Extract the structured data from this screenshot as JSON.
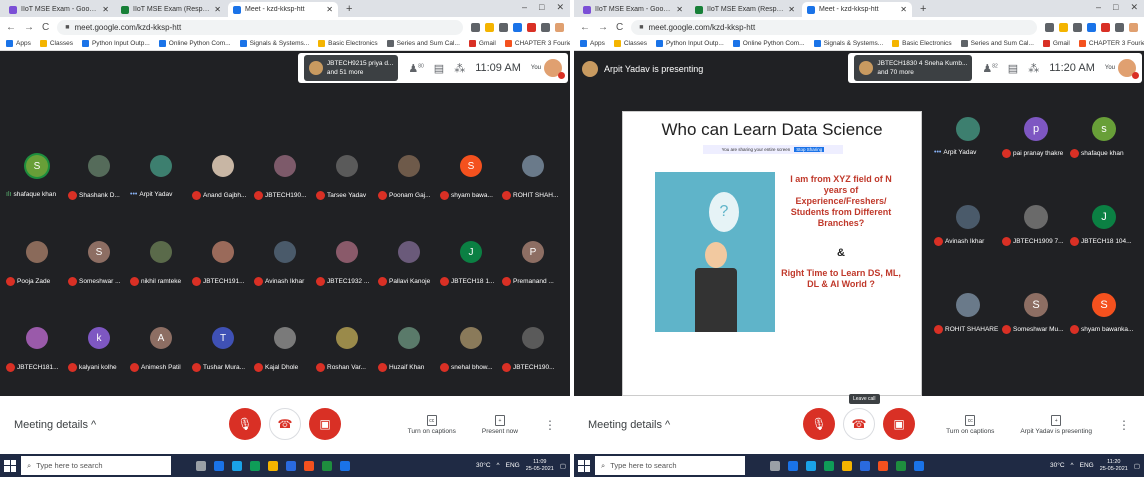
{
  "colors": {
    "accent_red": "#d93025",
    "meet_bg": "#202124",
    "taskbar": "#1f2a44",
    "speaking_green": "#1e8e3e"
  },
  "left": {
    "tabs": [
      {
        "label": "IIoT MSE Exam - Google Forms",
        "fav": "#7b4fd6"
      },
      {
        "label": "IIoT MSE Exam (Responses) - Go",
        "fav": "#188038"
      },
      {
        "label": "Meet - kzd-kksp-htt",
        "fav": "#1a73e8"
      }
    ],
    "url": "meet.google.com/kzd-kksp-htt",
    "bookmarks": [
      "Apps",
      "Classes",
      "Python Input Outp...",
      "Online Python Com...",
      "Signals & Systems...",
      "Basic Electronics",
      "Series and Sum Cal...",
      "Gmail",
      "CHAPTER 3 Fourier..."
    ],
    "joiner": "JBTECH9215 priya d...",
    "joiner2": "and 51 more",
    "people_count": "80",
    "time": "11:09 AM",
    "you_label": "You",
    "participants": [
      {
        "name": "shafaque khan",
        "initial": "S",
        "color": "#689f38",
        "speaking": true
      },
      {
        "name": "Shashank D...",
        "initial": "",
        "color": "#556b5a"
      },
      {
        "name": "Arpit Yadav",
        "initial": "",
        "color": "#3d7f6f",
        "dots": true
      },
      {
        "name": "Anand Gajbh...",
        "initial": "",
        "color": "#c8b6a4"
      },
      {
        "name": "JBTECH190...",
        "initial": "",
        "color": "#7d5a6a"
      },
      {
        "name": "Tarsee Yadav",
        "initial": "",
        "color": "#5a5a5a"
      },
      {
        "name": "Poonam Gaj...",
        "initial": "",
        "color": "#6e5a4a"
      },
      {
        "name": "shyam bawa...",
        "initial": "S",
        "color": "#f4511e"
      },
      {
        "name": "ROHIT SHAH...",
        "initial": "",
        "color": "#6a7a8a"
      },
      {
        "name": "Pooja Zade",
        "initial": "",
        "color": "#8a6a5a"
      },
      {
        "name": "Someshwar ...",
        "initial": "S",
        "color": "#8d6e63"
      },
      {
        "name": "nikhil ramteke",
        "initial": "",
        "color": "#5a6a4a"
      },
      {
        "name": "JBTECH191...",
        "initial": "",
        "color": "#9a6a5a"
      },
      {
        "name": "Avinash Ikhar",
        "initial": "",
        "color": "#4a5a6a"
      },
      {
        "name": "JBTEC1932 ...",
        "initial": "",
        "color": "#8a5a6a"
      },
      {
        "name": "Pallavi Kanoje",
        "initial": "",
        "color": "#6a5a7a"
      },
      {
        "name": "JBTECH18 1...",
        "initial": "J",
        "color": "#0b8043"
      },
      {
        "name": "Premanand ...",
        "initial": "P",
        "color": "#8d6e63"
      },
      {
        "name": "JBTECH181...",
        "initial": "",
        "color": "#9a5aaa"
      },
      {
        "name": "kalyani kolhe",
        "initial": "k",
        "color": "#7e57c2"
      },
      {
        "name": "Animesh Patil",
        "initial": "A",
        "color": "#8d6e63"
      },
      {
        "name": "Tushar Mura...",
        "initial": "T",
        "color": "#3f51b5"
      },
      {
        "name": "Kajal Dhole",
        "initial": "",
        "color": "#7a7a7a"
      },
      {
        "name": "Roshan Var...",
        "initial": "",
        "color": "#9a8a4a"
      },
      {
        "name": "Huzaif Khan",
        "initial": "",
        "color": "#5a7a6a"
      },
      {
        "name": "snehal bhow...",
        "initial": "",
        "color": "#8a7a5a"
      },
      {
        "name": "JBTECH190...",
        "initial": "",
        "color": "#5a5a5a"
      }
    ],
    "meeting_details": "Meeting details",
    "captions": "Turn on captions",
    "present": "Present now",
    "search": "Type here to search",
    "weather": "30°C",
    "lang": "ENG",
    "tray_time": "11:09",
    "tray_date": "25-05-2021"
  },
  "right": {
    "tabs": [
      {
        "label": "IIoT MSE Exam - Google Forms",
        "fav": "#7b4fd6"
      },
      {
        "label": "IIoT MSE Exam (Responses) - Goo",
        "fav": "#188038"
      },
      {
        "label": "Meet - kzd-kksp-htt",
        "fav": "#1a73e8"
      }
    ],
    "url": "meet.google.com/kzd-kksp-htt",
    "bookmarks": [
      "Apps",
      "Classes",
      "Python Input Outp...",
      "Online Python Com...",
      "Signals & Systems...",
      "Basic Electronics",
      "Series and Sum Cal...",
      "Gmail",
      "CHAPTER 3 Fourier..."
    ],
    "presenting": "Arpit Yadav is presenting",
    "joiner": "JBTECH1830 4 Sneha Kumb...",
    "joiner2": "and 70 more",
    "people_count": "82",
    "time": "11:20 AM",
    "you_label": "You",
    "slide": {
      "title": "Who can Learn Data Science",
      "share_text": "You are sharing your entire screen",
      "share_btn": "Stop Sharing",
      "qmark": "?",
      "line1": "I am from XYZ field of N years of Experience/Freshers/ Students from Different Branches?",
      "amp": "&",
      "line2": "Right Time to Learn DS, ML, DL & AI World ?"
    },
    "participants": [
      {
        "name": "Arpit Yadav",
        "initial": "",
        "color": "#3d7f6f",
        "dots": true
      },
      {
        "name": "pai pranay thakre",
        "initial": "p",
        "color": "#7e57c2"
      },
      {
        "name": "shafaque khan",
        "initial": "s",
        "color": "#689f38"
      },
      {
        "name": "Avinash Ikhar",
        "initial": "",
        "color": "#4a5a6a"
      },
      {
        "name": "JBTECH1909 7...",
        "initial": "",
        "color": "#6a6a6a"
      },
      {
        "name": "JBTECH18 104...",
        "initial": "J",
        "color": "#0b8043"
      },
      {
        "name": "ROHIT SHAHARE",
        "initial": "",
        "color": "#6a7a8a"
      },
      {
        "name": "Someshwar Mu...",
        "initial": "S",
        "color": "#8d6e63"
      },
      {
        "name": "shyam bawanka...",
        "initial": "S",
        "color": "#f4511e"
      }
    ],
    "leave_tip": "Leave call",
    "meeting_details": "Meeting details",
    "captions": "Turn on captions",
    "presenting_btn": "Arpit Yadav is presenting",
    "search": "Type here to search",
    "weather": "30°C",
    "lang": "ENG",
    "tray_time": "11:20",
    "tray_date": "25-05-2021"
  }
}
